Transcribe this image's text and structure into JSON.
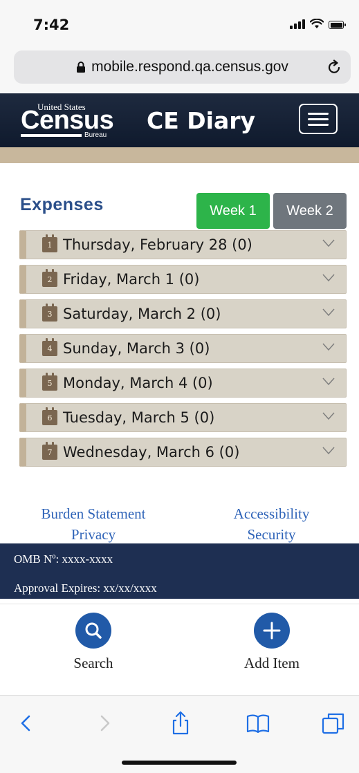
{
  "status_bar": {
    "time": "7:42"
  },
  "browser": {
    "url": "mobile.respond.qa.census.gov"
  },
  "header": {
    "logo": {
      "line1": "United States",
      "line2": "Census",
      "line3": "Bureau"
    },
    "title": "CE Diary"
  },
  "expenses": {
    "title": "Expenses",
    "week1_label": "Week 1",
    "week2_label": "Week 2",
    "active_week_color": "#2db44a",
    "days": [
      {
        "num": "1",
        "label": "Thursday, February 28 (0)"
      },
      {
        "num": "2",
        "label": "Friday, March 1 (0)"
      },
      {
        "num": "3",
        "label": "Saturday, March 2 (0)"
      },
      {
        "num": "4",
        "label": "Sunday, March 3 (0)"
      },
      {
        "num": "5",
        "label": "Monday, March 4 (0)"
      },
      {
        "num": "6",
        "label": "Tuesday, March 5 (0)"
      },
      {
        "num": "7",
        "label": "Wednesday, March 6 (0)"
      }
    ]
  },
  "footer": {
    "links": {
      "burden": "Burden Statement",
      "privacy": "Privacy",
      "accessibility": "Accessibility",
      "security": "Security"
    },
    "omb": "OMB Nº: xxxx-xxxx",
    "approval": "Approval Expires: xx/xx/xxxx"
  },
  "actions": {
    "search_label": "Search",
    "add_label": "Add Item"
  },
  "colors": {
    "header_navy": "#0f1a2d",
    "link_blue": "#2e63b8",
    "accent_blue": "#215aa8",
    "tan": "#c8b79c"
  }
}
